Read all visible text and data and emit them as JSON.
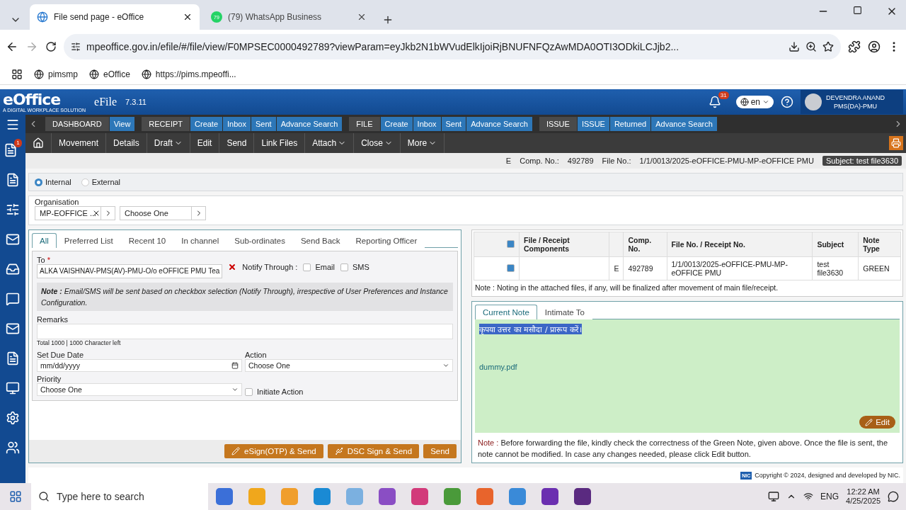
{
  "browser": {
    "tabs": [
      {
        "title": "File send page - eOffice",
        "selected": true,
        "kind": "globe"
      },
      {
        "title": "(79) WhatsApp Business",
        "selected": false,
        "kind": "whatsapp",
        "badge": "79"
      }
    ],
    "url": "mpeoffice.gov.in/efile/#/file/view/F0MPSEC0000492789?viewParam=eyJkb2N1bWVudElkIjoiRjBNUFNFQzAwMDA0OTI3ODkiLCJjb2...",
    "bookmarks": [
      "pimsmp",
      "eOffice",
      "https://pims.mpeoffi..."
    ]
  },
  "header": {
    "logo": "eOffice",
    "tagline": "A DIGITAL WORKPLACE SOLUTION",
    "app": "eFile",
    "version": "7.3.11",
    "notifications": "31",
    "language": "en",
    "user": {
      "name": "DEVENDRA ANAND",
      "role": "PMS(DA)-PMU"
    }
  },
  "nav": [
    {
      "label": "DASHBOARD",
      "links": [
        "View"
      ]
    },
    {
      "label": "RECEIPT",
      "links": [
        "Create",
        "Inbox",
        "Sent",
        "Advance Search"
      ]
    },
    {
      "label": "FILE",
      "links": [
        "Create",
        "Inbox",
        "Sent",
        "Advance Search"
      ]
    },
    {
      "label": "ISSUE",
      "links": [
        "ISSUE",
        "Returned",
        "Advance Search"
      ]
    }
  ],
  "toolbar": [
    {
      "label": "Movement",
      "dropdown": false
    },
    {
      "label": "Details",
      "dropdown": false
    },
    {
      "label": "Draft",
      "dropdown": true
    },
    {
      "label": "Edit",
      "dropdown": false
    },
    {
      "label": "Send",
      "dropdown": false
    },
    {
      "label": "Link Files",
      "dropdown": false
    },
    {
      "label": "Attach",
      "dropdown": true
    },
    {
      "label": "Close",
      "dropdown": true
    },
    {
      "label": "More",
      "dropdown": true
    }
  ],
  "sidebar": {
    "badge": "1"
  },
  "info": {
    "type": "E",
    "comp_label": "Comp. No.:",
    "comp": "492789",
    "file_label": "File No.:",
    "file": "1/1/0013/2025-eOFFICE-PMU-MP-eOFFICE PMU",
    "subject": "Subject: test file3630"
  },
  "send": {
    "recipient_type": [
      {
        "label": "Internal",
        "selected": true
      },
      {
        "label": "External",
        "selected": false
      }
    ],
    "organisation": {
      "label": "Organisation",
      "value": "MP-EOFFICE ...",
      "second": "Choose One"
    },
    "tabs": [
      {
        "label": "All",
        "selected": true
      },
      {
        "label": "Preferred List",
        "selected": false
      },
      {
        "label": "Recent 10",
        "selected": false
      },
      {
        "label": "In channel",
        "selected": false
      },
      {
        "label": "Sub-ordinates",
        "selected": false
      },
      {
        "label": "Send Back",
        "selected": false
      },
      {
        "label": "Reporting Officer",
        "selected": false
      }
    ],
    "to": {
      "label": "To",
      "required_mark": "*",
      "value": "ALKA VAISHNAV-PMS(AV)-PMU-O/o eOFFICE PMU Tea"
    },
    "notify": {
      "label": "Notify Through :",
      "options": [
        {
          "label": "Email",
          "checked": false
        },
        {
          "label": "SMS",
          "checked": false
        }
      ]
    },
    "note": "**Note :** Email/SMS will be sent based on checkbox selection (Notify Through), irrespective of User Preferences and Instance Configuration.",
    "remarks": {
      "label": "Remarks",
      "counter": "Total 1000 | 1000 Character left"
    },
    "due_date": {
      "label": "Set Due Date",
      "placeholder": "mm/dd/yyyy"
    },
    "action": {
      "label": "Action",
      "value": "Choose One"
    },
    "priority": {
      "label": "Priority",
      "value": "Choose One"
    },
    "initiate_action": {
      "label": "Initiate Action",
      "checked": false
    },
    "buttons": [
      {
        "label": "eSign(OTP) & Send",
        "kind": "esign"
      },
      {
        "label": "DSC Sign & Send",
        "kind": "dsc"
      },
      {
        "label": "Send",
        "kind": "plain"
      }
    ]
  },
  "components": {
    "header_checked": true,
    "columns": [
      "File / Receipt Components",
      "",
      "Comp. No.",
      "File No. / Receipt No.",
      "Subject",
      "Note Type"
    ],
    "rows": [
      {
        "checked": true,
        "cells": [
          "",
          "E",
          "492789",
          "1/1/0013/2025-eOFFICE-PMU-MP-eOFFICE PMU",
          "test file3630",
          "GREEN"
        ]
      }
    ],
    "note": "Note : Noting in the attached files, if any, will be finalized after movement of main file/receipt."
  },
  "green_note": {
    "tabs": [
      {
        "label": "Current Note",
        "selected": true
      },
      {
        "label": "Intimate To",
        "selected": false
      }
    ],
    "text": "कृपया उत्तर का मसौदा / प्रारूप करें।",
    "attachment": "dummy.pdf",
    "edit": "Edit",
    "warning_label": "Note :",
    "warning": "Before forwarding the file, kindly check the correctness of the Green Note, given above. Once the file is sent, the note cannot be modified. In case any changes needed, please click Edit button."
  },
  "footer": {
    "badge": "NIC",
    "text": "Copyright © 2024, designed and developed by NIC."
  },
  "taskbar": {
    "search": "Type here to search",
    "language": "ENG",
    "time": "12:22 AM",
    "date": "4/25/2025"
  }
}
